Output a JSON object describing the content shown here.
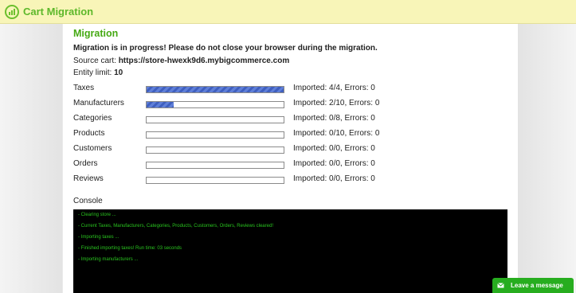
{
  "app": {
    "title": "Cart Migration"
  },
  "migration": {
    "heading": "Migration",
    "warning": "Migration is in progress! Please do not close your browser during the migration.",
    "source_label": "Source cart:",
    "source_value": "https://store-hwexk9d6.mybigcommerce.com",
    "limit_label": "Entity limit:",
    "limit_value": "10"
  },
  "entities": [
    {
      "label": "Taxes",
      "status": "Imported: 4/4, Errors: 0",
      "progress": 1.0
    },
    {
      "label": "Manufacturers",
      "status": "Imported: 2/10, Errors: 0",
      "progress": 0.2
    },
    {
      "label": "Categories",
      "status": "Imported: 0/8, Errors: 0",
      "progress": 0
    },
    {
      "label": "Products",
      "status": "Imported: 0/10, Errors: 0",
      "progress": 0
    },
    {
      "label": "Customers",
      "status": "Imported: 0/0, Errors: 0",
      "progress": 0
    },
    {
      "label": "Orders",
      "status": "Imported: 0/0, Errors: 0",
      "progress": 0
    },
    {
      "label": "Reviews",
      "status": "Imported: 0/0, Errors: 0",
      "progress": 0
    }
  ],
  "console": {
    "label": "Console",
    "lines": [
      "- Clearing store ...",
      "- Current Taxes, Manufacturers, Categories, Products, Customers, Orders, Reviews cleared!",
      "- Importing taxes ...",
      "- Finished importing taxes! Run time: 03 seconds",
      "- Importing manufacturers ..."
    ]
  },
  "chat": {
    "label": "Leave a message",
    "icon": "envelope-icon"
  },
  "colors": {
    "accent_green": "#45a913",
    "progress_blue": "#4f6fce",
    "console_text": "#29c41f"
  }
}
